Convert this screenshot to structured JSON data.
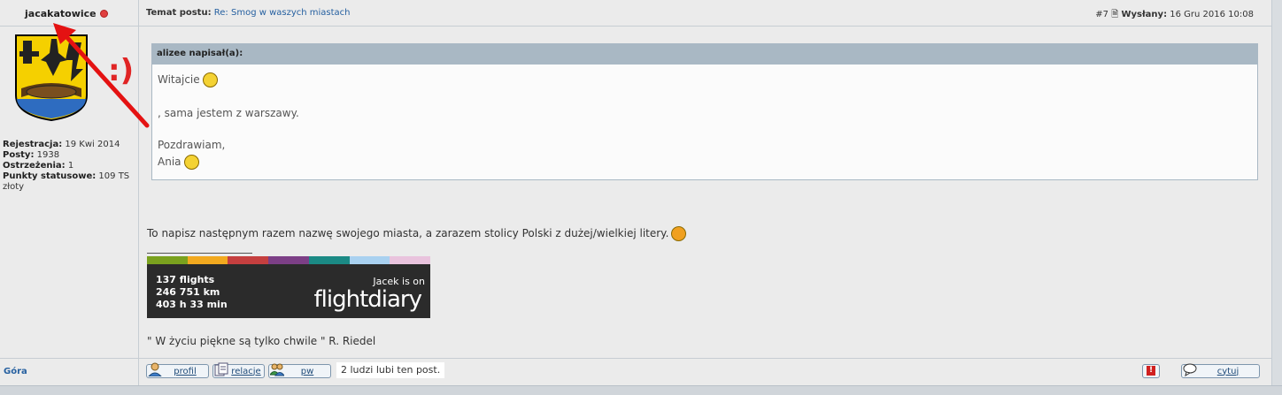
{
  "author": {
    "name": "jacakatowice",
    "status_color": "#e04040",
    "emoticon_text": ":)",
    "info": [
      {
        "label": "Rejestracja:",
        "value": "19 Kwi 2014"
      },
      {
        "label": "Posty:",
        "value": "1938"
      },
      {
        "label": "Ostrzeżenia:",
        "value": "1"
      },
      {
        "label": "Punkty statusowe:",
        "value": "109 TS"
      }
    ],
    "extra": "złoty"
  },
  "post": {
    "topic_label": "Temat postu:",
    "topic_link": "Re: Smog w waszych miastach",
    "number": "#7",
    "sent_label": "Wysłany:",
    "sent_date": "16 Gru 2016 10:08"
  },
  "quote": {
    "header": "alizee napisał(a):",
    "lines": [
      "Witajcie",
      ", sama jestem z warszawy.",
      "Pozdrawiam,",
      "Ania"
    ]
  },
  "message": "To napisz następnym razem nazwę swojego miasta, a zarazem stolicy Polski z dużej/wielkiej litery.",
  "signature": {
    "flightdiary": {
      "stats": [
        "137 flights",
        "246 751 km",
        "403 h 33 min"
      ],
      "user_text": "Jacek is on",
      "logo_text": "flightdiary",
      "stripe_colors": [
        "#7aa11e",
        "#f2a91f",
        "#c53f3f",
        "#7c3f86",
        "#1b8a85",
        "#a9d1f0",
        "#e9c3dd"
      ]
    },
    "quote": "\" W życiu piękne są tylko chwile \" R. Riedel"
  },
  "footer": {
    "top_link": "Góra",
    "buttons": {
      "profile": "profil",
      "relations": "relacje",
      "pm": "pw",
      "quote": "cytuj"
    },
    "likes": "2 ludzi lubi ten post."
  }
}
